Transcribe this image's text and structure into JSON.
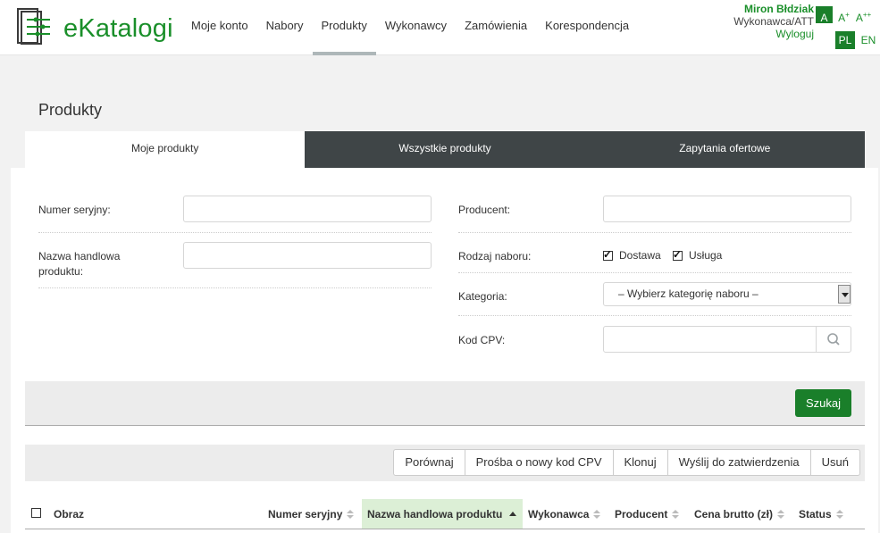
{
  "header": {
    "logo_text": "eKatalogi",
    "nav": [
      "Moje konto",
      "Nabory",
      "Produkty",
      "Wykonawcy",
      "Zamówienia",
      "Korespondencja"
    ],
    "active_nav": "Produkty",
    "user": {
      "name": "Miron Błdziak",
      "role": "Wykonawca/ATT",
      "logout": "Wyloguj"
    },
    "font_sizes": [
      "A",
      "A",
      "A"
    ],
    "font_size_marks": [
      "",
      "+",
      "++"
    ],
    "languages": [
      "PL",
      "EN"
    ],
    "active_language": "PL"
  },
  "page": {
    "title": "Produkty",
    "tabs": [
      "Moje produkty",
      "Wszystkie produkty",
      "Zapytania ofertowe"
    ],
    "active_tab": "Moje produkty"
  },
  "form": {
    "serial_label": "Numer seryjny:",
    "serial_value": "",
    "trade_name_label": "Nazwa handlowa produktu:",
    "trade_name_value": "",
    "producer_label": "Producent:",
    "producer_value": "",
    "recruitment_type_label": "Rodzaj naboru:",
    "recruitment_types": [
      {
        "label": "Dostawa",
        "checked": true
      },
      {
        "label": "Usługa",
        "checked": true
      }
    ],
    "category_label": "Kategoria:",
    "category_selected": "– Wybierz kategorię naboru –",
    "cpv_label": "Kod CPV:",
    "cpv_value": "",
    "search_button": "Szukaj"
  },
  "actions": [
    "Porównaj",
    "Prośba o nowy kod CPV",
    "Klonuj",
    "Wyślij do zatwierdzenia",
    "Usuń"
  ],
  "table": {
    "columns": [
      "Obraz",
      "Numer seryjny",
      "Nazwa handlowa produktu",
      "Wykonawca",
      "Producent",
      "Cena brutto (zł)",
      "Status"
    ],
    "sorted_column": "Nazwa handlowa produktu",
    "sort_direction": "ascending"
  },
  "colors": {
    "brand_green": "#1a8f2a",
    "button_green": "#1a7f2a",
    "tab_dark": "#3f4547",
    "sorted_column_bg": "#dcefd6"
  }
}
